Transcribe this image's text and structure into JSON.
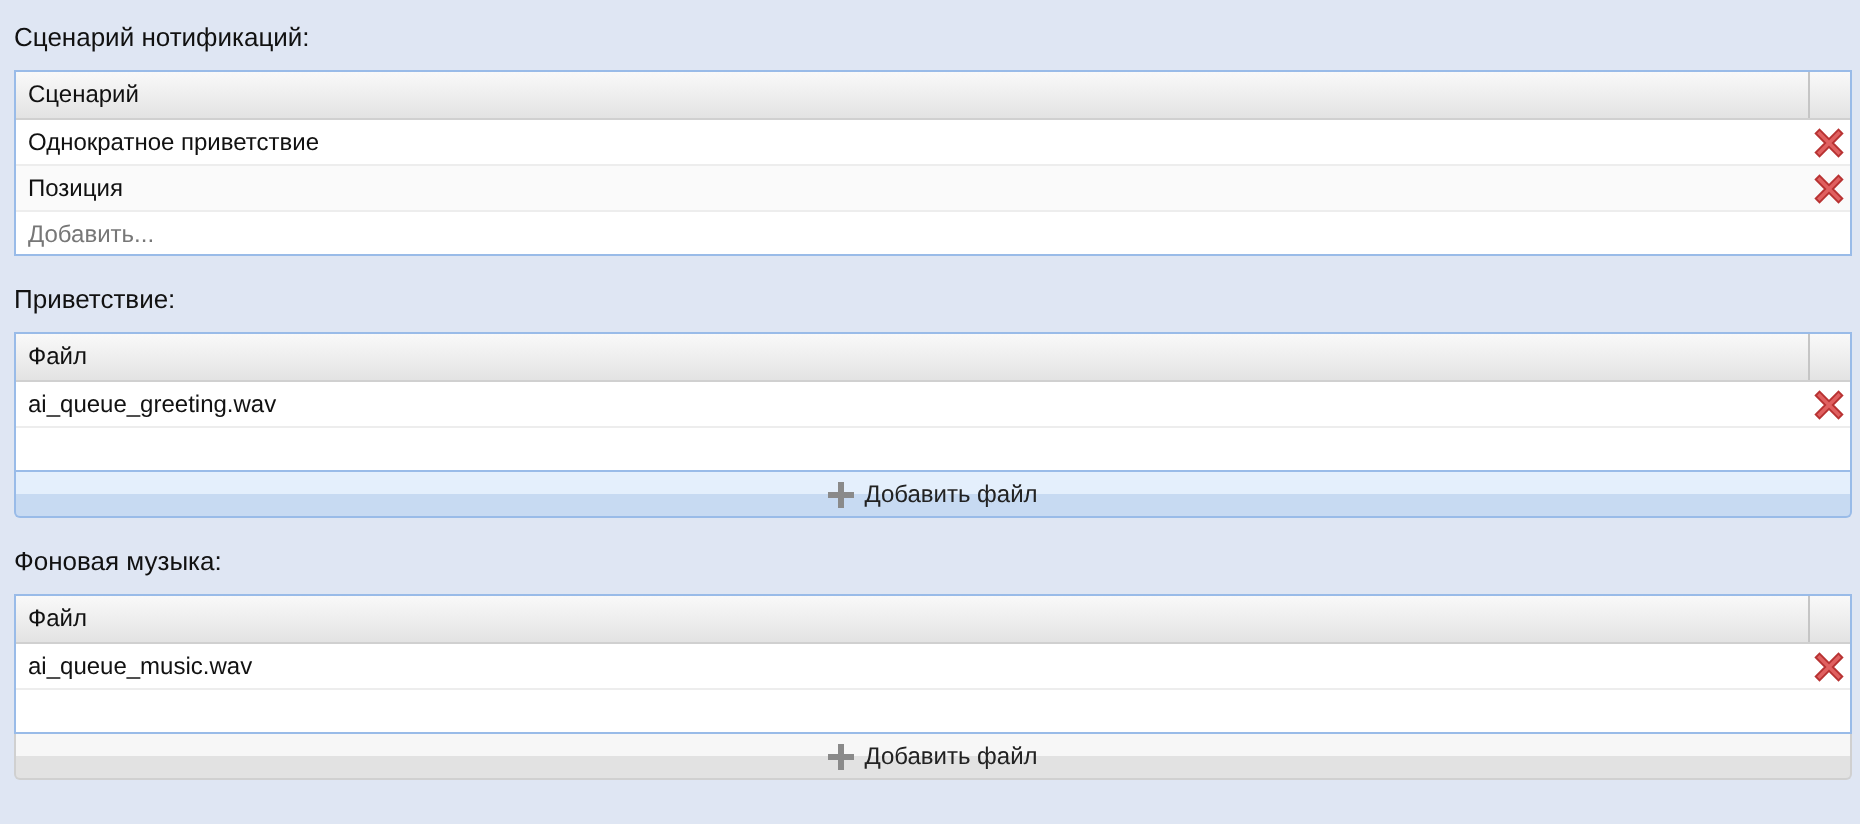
{
  "sections": [
    {
      "title": "Сценарий нотификаций:",
      "column": "Сценарий",
      "rows": [
        {
          "text": "Однократное приветствие"
        },
        {
          "text": "Позиция"
        }
      ],
      "add_placeholder": "Добавить..."
    },
    {
      "title": "Приветствие:",
      "column": "Файл",
      "rows": [
        {
          "text": "ai_queue_greeting.wav"
        }
      ],
      "add_button": {
        "label": "Добавить файл",
        "highlighted": true
      }
    },
    {
      "title": "Фоновая музыка:",
      "column": "Файл",
      "rows": [
        {
          "text": "ai_queue_music.wav"
        }
      ],
      "add_button": {
        "label": "Добавить файл",
        "highlighted": false
      }
    }
  ]
}
